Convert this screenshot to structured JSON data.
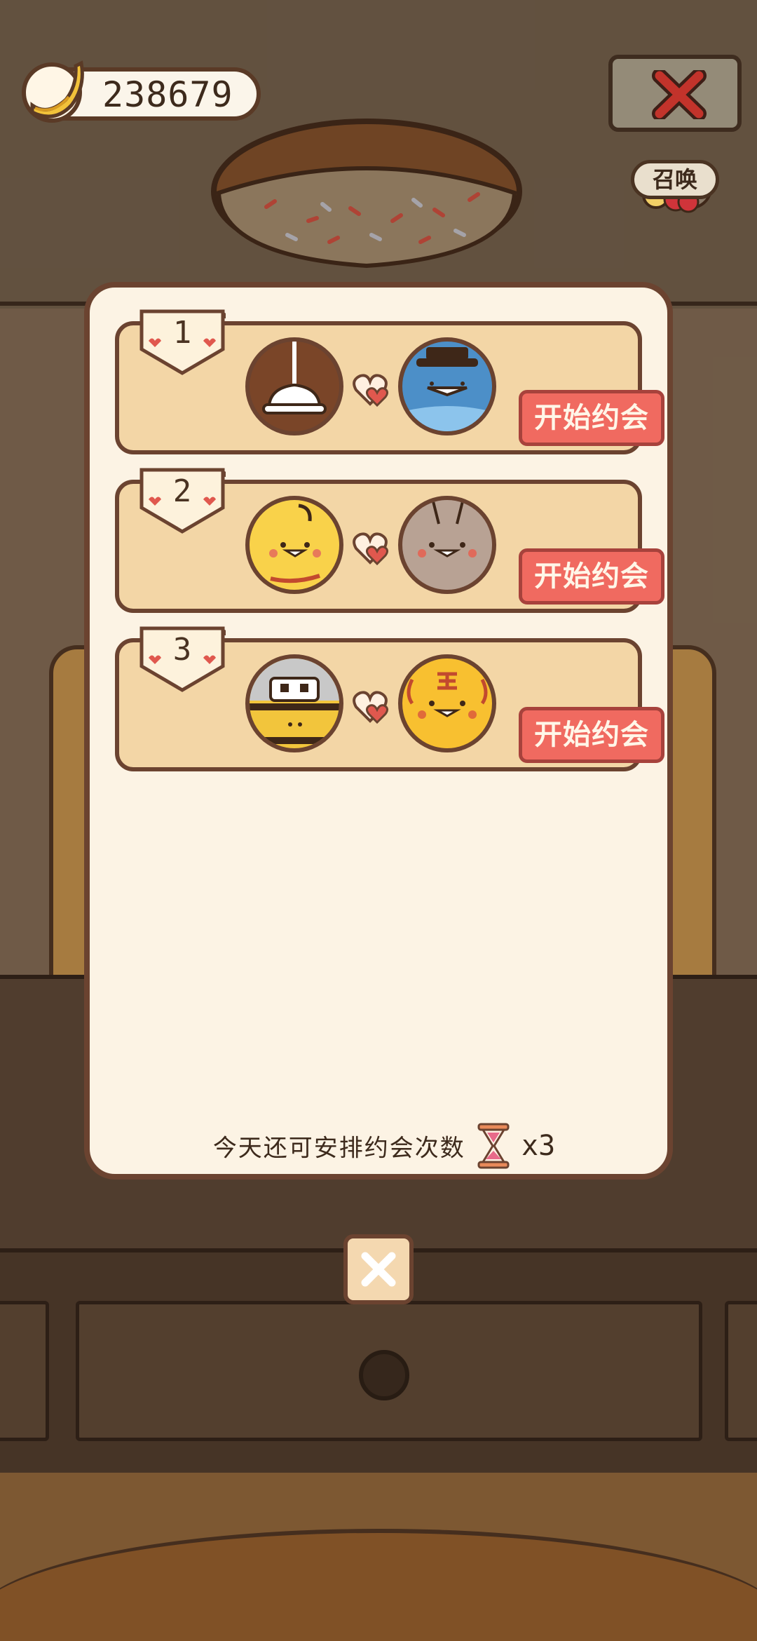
{
  "hud": {
    "coins": "238679",
    "summon_label": "召唤"
  },
  "dates": [
    {
      "rank": "1",
      "button": "开始约会",
      "left_avatar": "ceiling-lamp-character",
      "right_avatar": "blue-hat-character"
    },
    {
      "rank": "2",
      "button": "开始约会",
      "left_avatar": "yellow-chick-character",
      "right_avatar": "gray-rabbit-character"
    },
    {
      "rank": "3",
      "button": "开始约会",
      "left_avatar": "robot-helmet-character",
      "right_avatar": "tiger-character"
    }
  ],
  "footer": {
    "text": "今天还可安排约会次数",
    "count": "x3"
  },
  "colors": {
    "button": "#f06a60",
    "row": "#f3d6a6",
    "panel": "#fcf3e4",
    "outline": "#6b4330"
  }
}
